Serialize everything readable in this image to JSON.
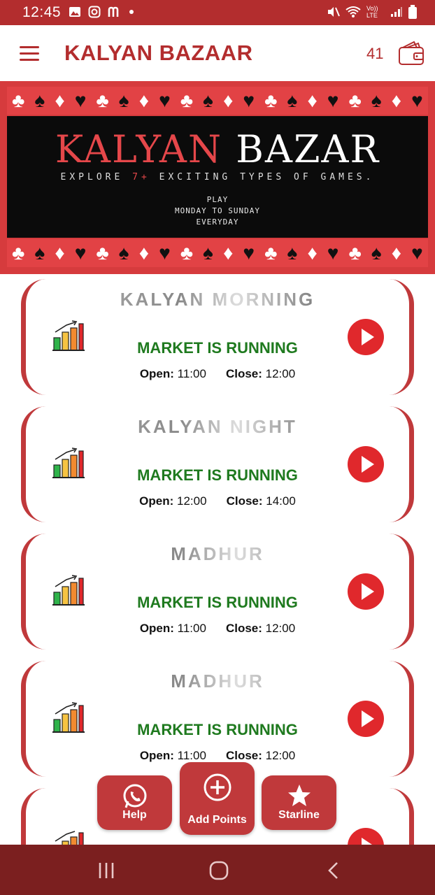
{
  "status_bar": {
    "time": "12:45",
    "volte": "Vo)) LTE"
  },
  "app_bar": {
    "title": "KALYAN BAZAAR",
    "points": "41"
  },
  "banner": {
    "brand_part1": "KALYAN",
    "brand_part2": "BAZAR",
    "explore_pre": "EXPLORE ",
    "explore_hl": "7+",
    "explore_post": " EXCITING TYPES OF GAMES.",
    "play_line1": "PLAY",
    "play_line2": "MONDAY TO SUNDAY",
    "play_line3": "EVERYDAY"
  },
  "markets": [
    {
      "name": "KALYAN MORNING",
      "status": "MARKET IS RUNNING",
      "open_label": "Open:",
      "open": "11:00",
      "close_label": "Close:",
      "close": "12:00"
    },
    {
      "name": "KALYAN NIGHT",
      "status": "MARKET IS RUNNING",
      "open_label": "Open:",
      "open": "12:00",
      "close_label": "Close:",
      "close": "14:00"
    },
    {
      "name": "MADHUR",
      "status": "MARKET IS RUNNING",
      "open_label": "Open:",
      "open": "11:00",
      "close_label": "Close:",
      "close": "12:00"
    },
    {
      "name": "MADHUR",
      "status": "MARKET IS RUNNING",
      "open_label": "Open:",
      "open": "11:00",
      "close_label": "Close:",
      "close": "12:00"
    }
  ],
  "fabs": {
    "help": "Help",
    "add_points": "Add Points",
    "starline": "Starline"
  },
  "colors": {
    "primary": "#b32d2e",
    "running": "#1f7a1f",
    "play": "#e0282c",
    "nav": "#7b1f1f"
  }
}
